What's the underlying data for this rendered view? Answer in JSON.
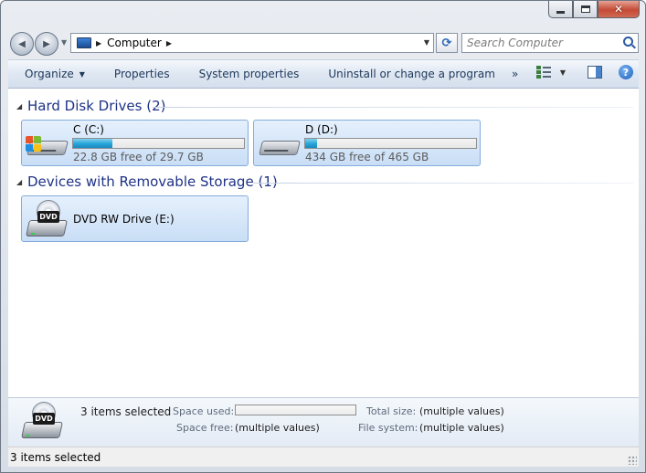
{
  "window": {
    "controls": {
      "minimize_icon": "minimize-icon",
      "maximize_icon": "maximize-icon",
      "close_glyph": "✕"
    }
  },
  "nav": {
    "back_glyph": "◀",
    "forward_glyph": "▶",
    "address": {
      "crumb": "Computer",
      "separator": "▶"
    },
    "search": {
      "placeholder": "Search Computer"
    }
  },
  "command_bar": {
    "organize": "Organize",
    "properties": "Properties",
    "system_properties": "System properties",
    "uninstall": "Uninstall or change a program",
    "more": "»"
  },
  "groups": {
    "hard_disks": {
      "title": "Hard Disk Drives (2)",
      "drives": [
        {
          "name": "C (C:)",
          "free_text": "22.8 GB free of 29.7 GB",
          "used_fraction": 0.23
        },
        {
          "name": "D (D:)",
          "free_text": "434 GB free of 465 GB",
          "used_fraction": 0.067
        }
      ]
    },
    "removable": {
      "title": "Devices with Removable Storage (1)",
      "devices": [
        {
          "name": "DVD RW Drive (E:)",
          "icon_label": "DVD"
        }
      ]
    }
  },
  "details": {
    "selection": "3 items selected",
    "icon_label": "DVD",
    "space_used_label": "Space used:",
    "space_free_label": "Space free:",
    "space_free_value": "(multiple values)",
    "total_size_label": "Total size:",
    "total_size_value": "(multiple values)",
    "file_system_label": "File system:",
    "file_system_value": "(multiple values)"
  },
  "status_bar": {
    "text": "3 items selected"
  },
  "colors": {
    "accent": "#1e3287",
    "bar_fill": "#27a4d8",
    "tile_border": "#84acdd"
  }
}
